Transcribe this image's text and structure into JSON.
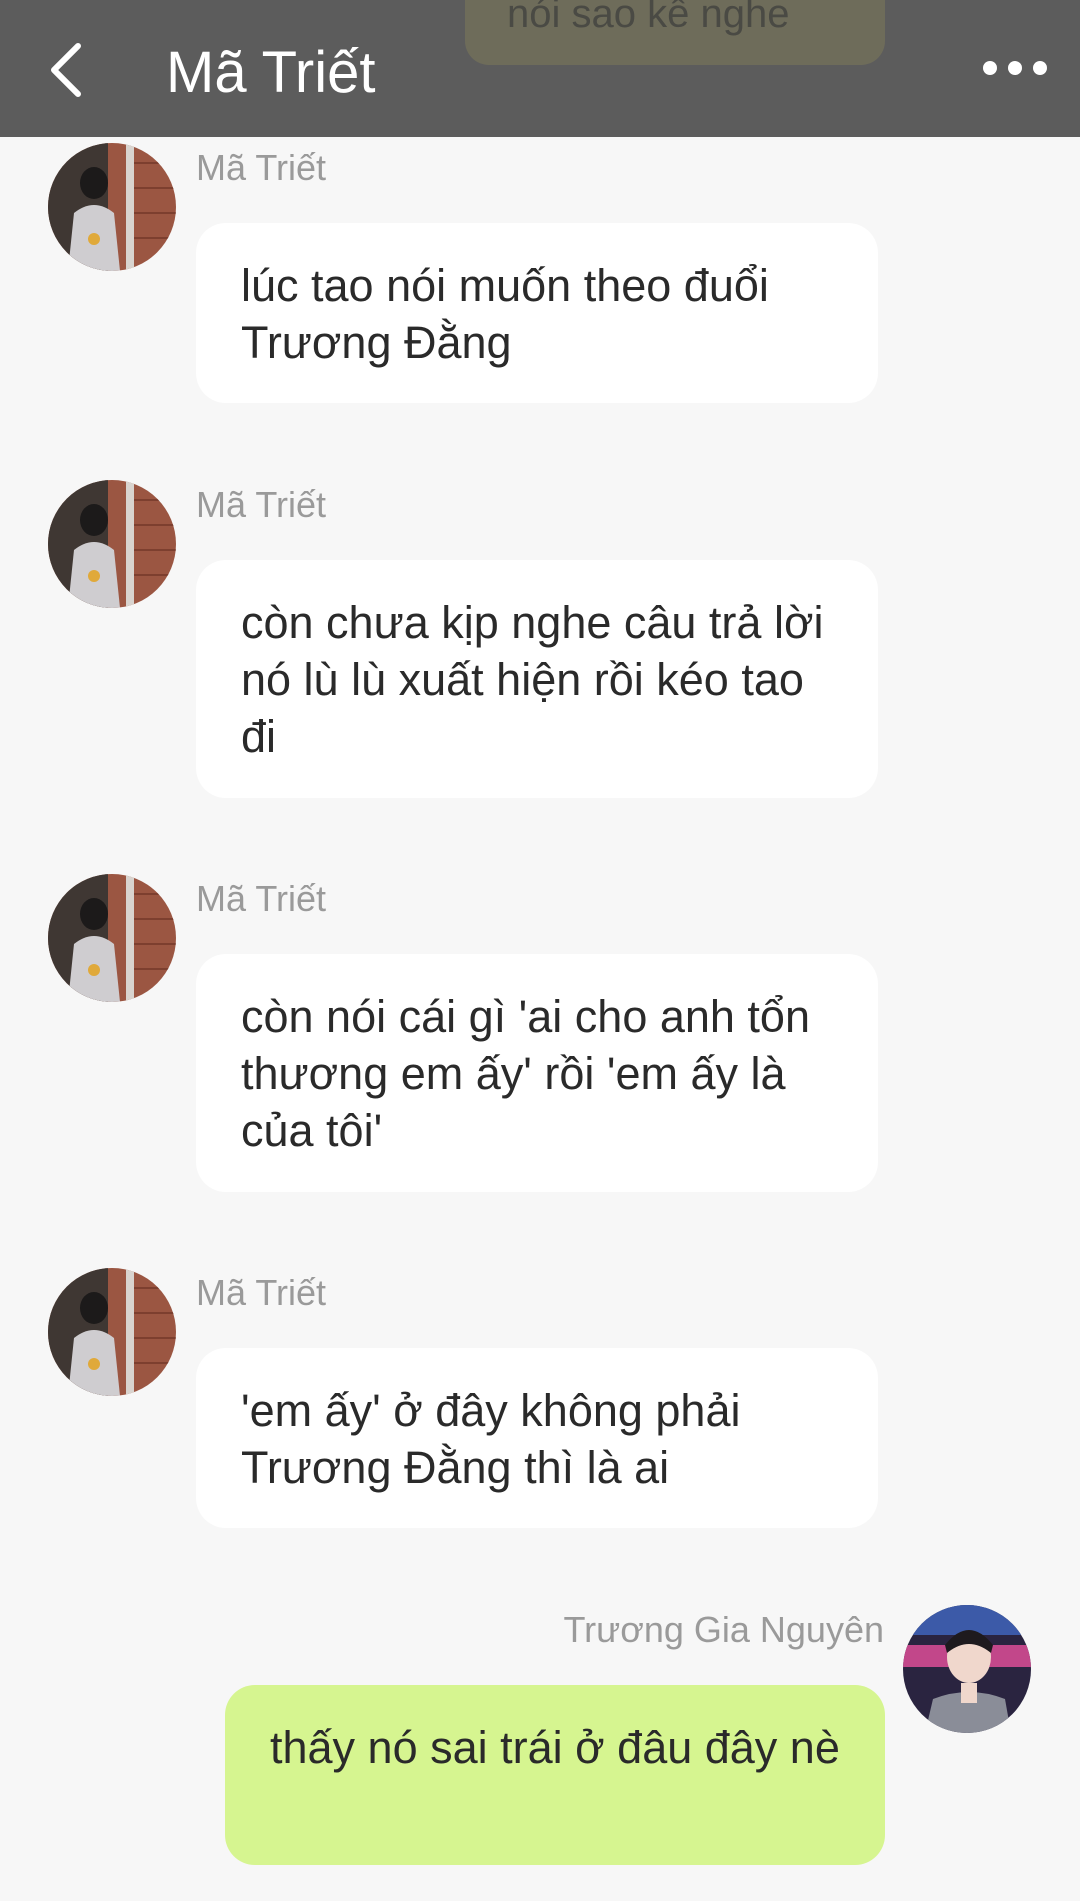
{
  "header": {
    "title": "Mã Triết",
    "back_icon": "chevron-left-icon",
    "more_icon": "more-horizontal-icon",
    "peek_text": "nói sao kể nghe"
  },
  "colors": {
    "header_bg": "#5c5c5c",
    "page_bg": "#f7f7f7",
    "incoming_bubble": "#ffffff",
    "outgoing_bubble": "#d6f590",
    "sender_text": "#9a9a9a"
  },
  "messages": [
    {
      "sender": "Mã Triết",
      "text": "lúc tao nói muốn theo đuổi Trương Đằng",
      "side": "left"
    },
    {
      "sender": "Mã Triết",
      "text": "còn chưa kịp nghe câu trả lời nó lù lù xuất hiện rồi kéo tao đi",
      "side": "left"
    },
    {
      "sender": "Mã Triết",
      "text": "còn nói cái gì 'ai cho anh tổn thương em ấy' rồi 'em ấy là của tôi'",
      "side": "left"
    },
    {
      "sender": "Mã Triết",
      "text": "'em ấy' ở đây không phải Trương Đằng thì là ai",
      "side": "left"
    },
    {
      "sender": "Trương Gia Nguyên",
      "text": "thấy nó sai trái ở đâu đây nè",
      "side": "right"
    }
  ]
}
